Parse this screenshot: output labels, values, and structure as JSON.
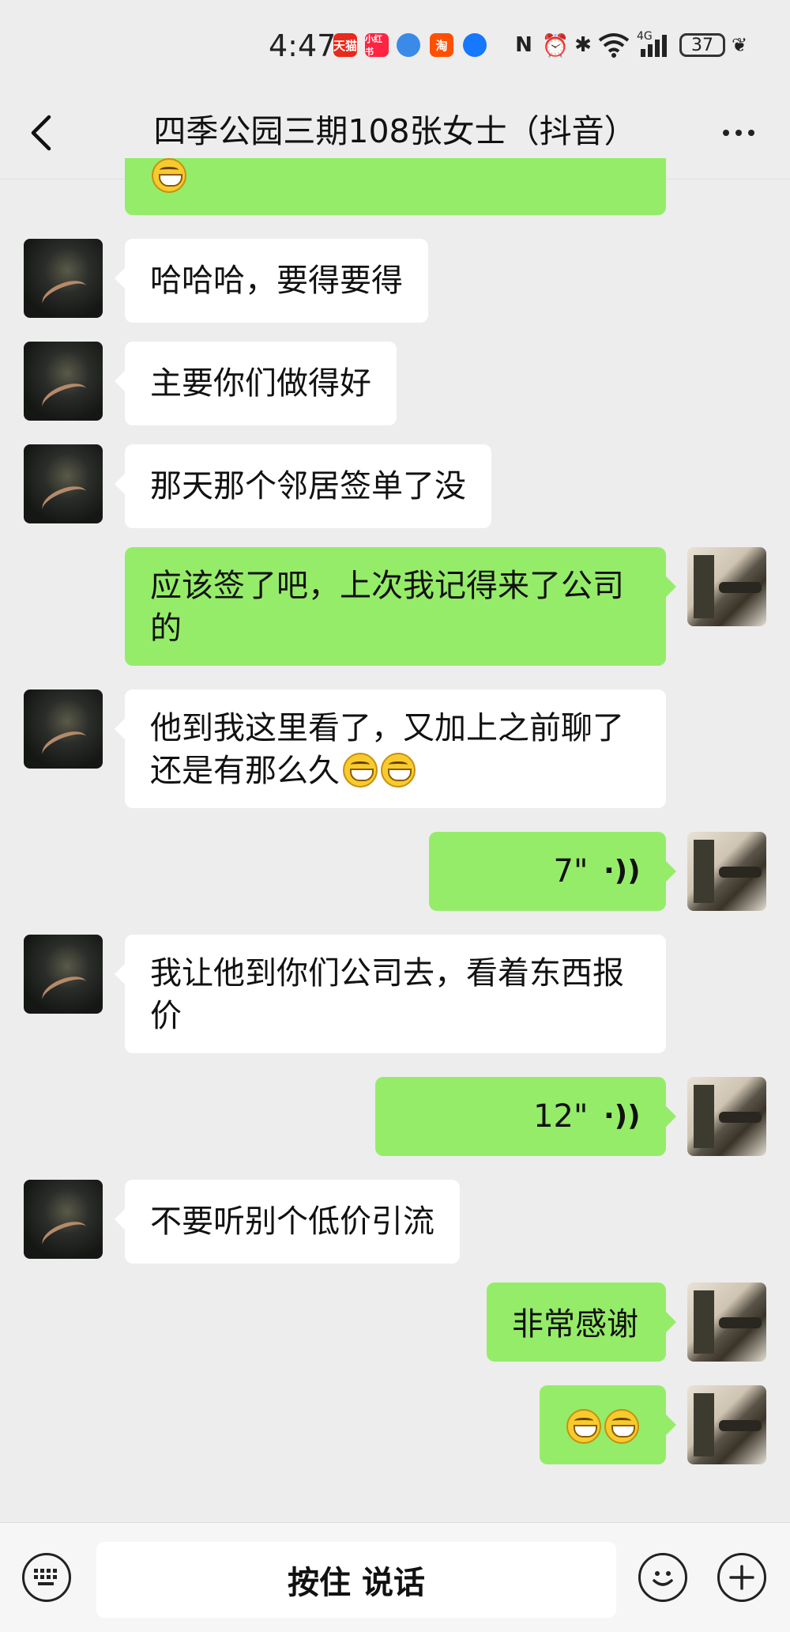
{
  "status_bar": {
    "time": "4:47",
    "app_icons": [
      {
        "name": "tmall-icon",
        "text": "天猫",
        "color": "#e8291c"
      },
      {
        "name": "xiaohongshu-icon",
        "text": "小红书",
        "color": "#ff2442"
      },
      {
        "name": "app-icon-blue",
        "text": "",
        "color": "#3a8be8"
      },
      {
        "name": "taobao-icon",
        "text": "淘",
        "color": "#ff5000"
      },
      {
        "name": "app-icon-compass",
        "text": "",
        "color": "#1677ff"
      }
    ],
    "network": "4G",
    "battery": "37"
  },
  "header": {
    "title": "四季公园三期108张女士（抖音）"
  },
  "messages": [
    {
      "from": "me",
      "text": ""
    },
    {
      "from": "her",
      "text": "哈哈哈，要得要得"
    },
    {
      "from": "her",
      "text": "主要你们做得好"
    },
    {
      "from": "her",
      "text": "那天那个邻居签单了没"
    },
    {
      "from": "me",
      "line1": "应该签了吧，上次我记得来了公司",
      "line2": "的"
    },
    {
      "from": "her",
      "line1": "他到我这里看了，又加上之前聊了",
      "line2": "还是有那么久"
    },
    {
      "from": "me",
      "type": "voice",
      "duration": "7\""
    },
    {
      "from": "her",
      "line1": "我让他到你们公司去，看着东西报",
      "line2": "价"
    },
    {
      "from": "me",
      "type": "voice",
      "duration": "12\""
    },
    {
      "from": "her",
      "text": "不要听别个低价引流"
    },
    {
      "from": "me",
      "text": "非常感谢"
    },
    {
      "from": "me",
      "text": ""
    }
  ],
  "input_bar": {
    "hold_to_talk": "按住 说话"
  }
}
